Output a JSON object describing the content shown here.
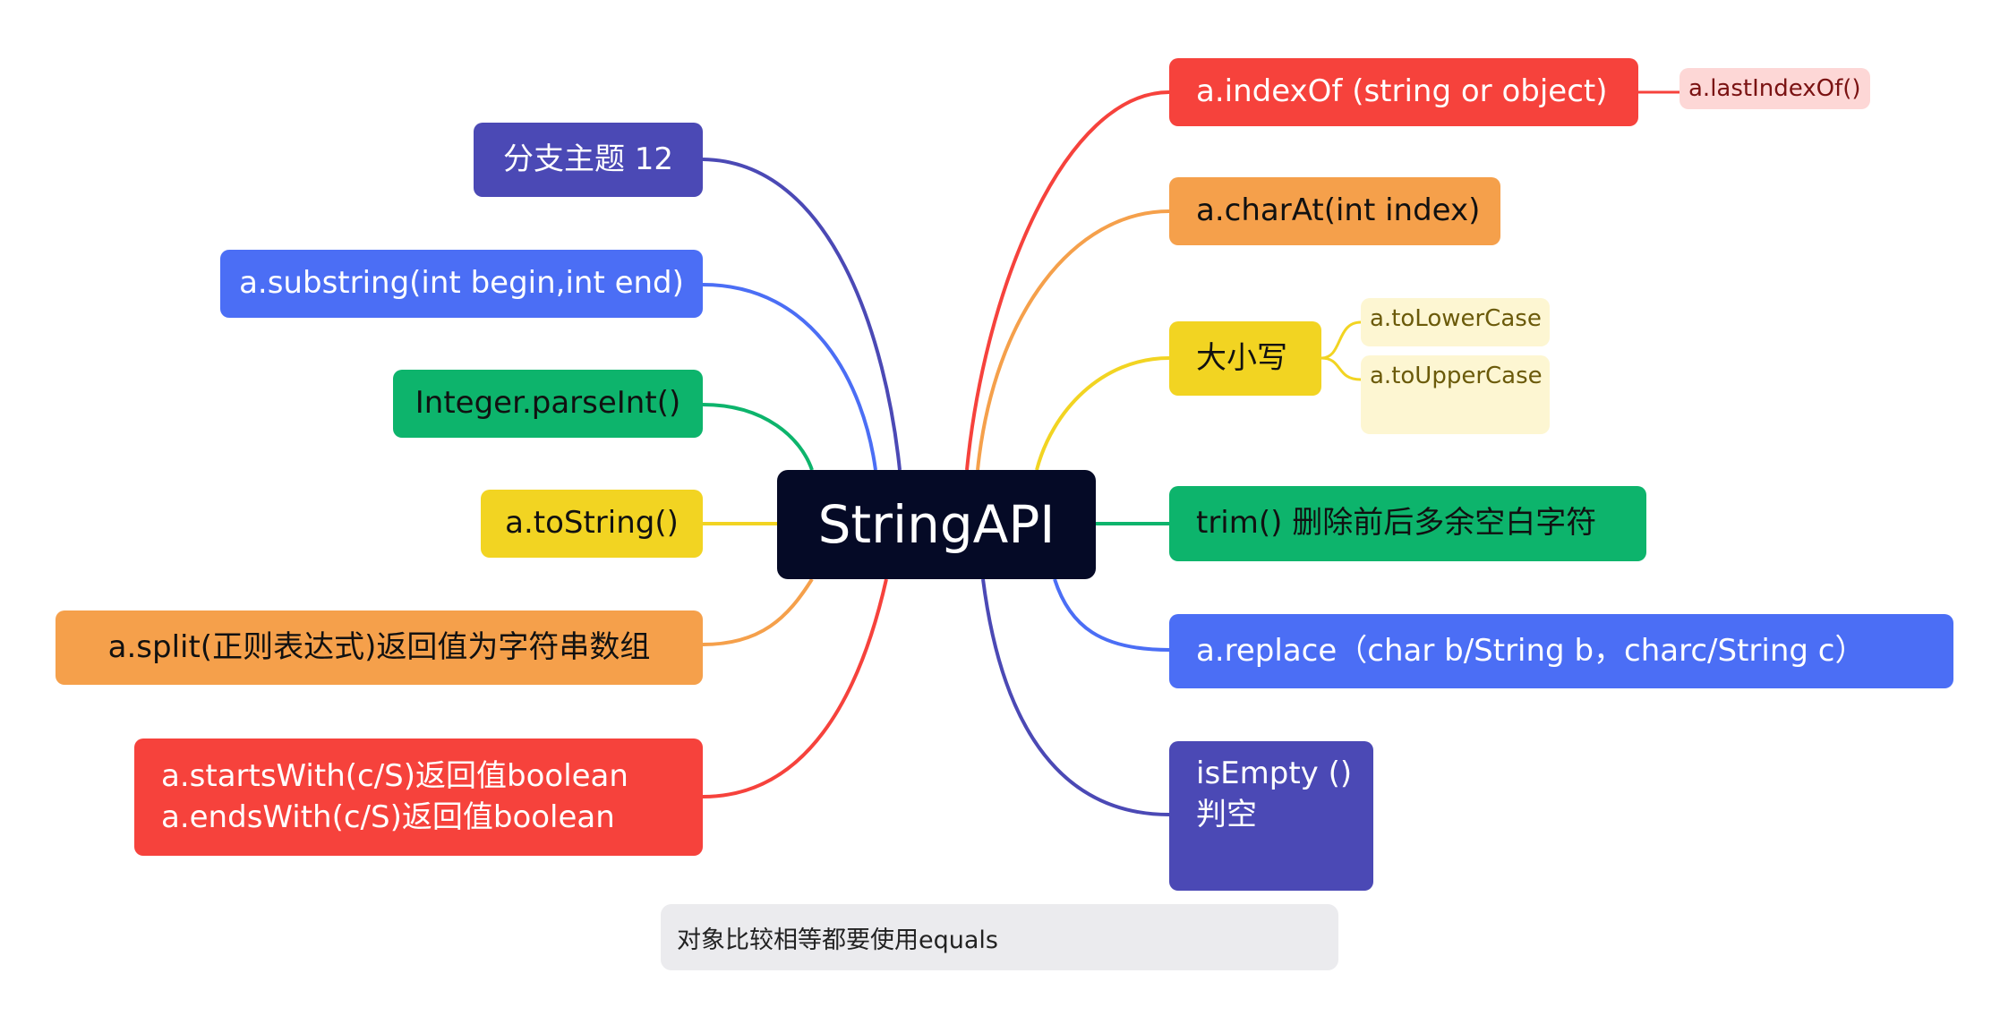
{
  "root": {
    "label": "StringAPI"
  },
  "left_branches": [
    {
      "label": "分支主题 12",
      "color": "#4b49b5"
    },
    {
      "label": "a.substring(int begin,int end)",
      "color": "#4b6ef5"
    },
    {
      "label": "Integer.parseInt()",
      "color": "#0db46c"
    },
    {
      "label": "a.toString()",
      "color": "#f2d422"
    },
    {
      "label": "a.split(正则表达式)返回值为字符串数组",
      "color": "#f5a04b"
    },
    {
      "lines": [
        "a.startsWith(c/S)返回值boolean",
        "a.endsWith(c/S)返回值boolean"
      ],
      "color": "#f6423c"
    }
  ],
  "right_branches": [
    {
      "label": "a.indexOf (string or object)",
      "color": "#f6423c",
      "children": [
        {
          "label": "a.lastIndexOf()"
        }
      ]
    },
    {
      "label": "a.charAt(int index)",
      "color": "#f5a04b"
    },
    {
      "label": "大小写",
      "color": "#f2d422",
      "children": [
        {
          "label": "a.toLowerCase"
        },
        {
          "label": "a.toUpperCase"
        }
      ]
    },
    {
      "label": "trim() 删除前后多余空白字符",
      "color": "#0db46c"
    },
    {
      "label": "a.replace（char b/String b，charc/String c）",
      "color": "#4b6ef5"
    },
    {
      "lines": [
        "isEmpty ()",
        "判空"
      ],
      "color": "#4b49b5"
    }
  ],
  "floating_note": {
    "label": "对象比较相等都要使用equals"
  }
}
